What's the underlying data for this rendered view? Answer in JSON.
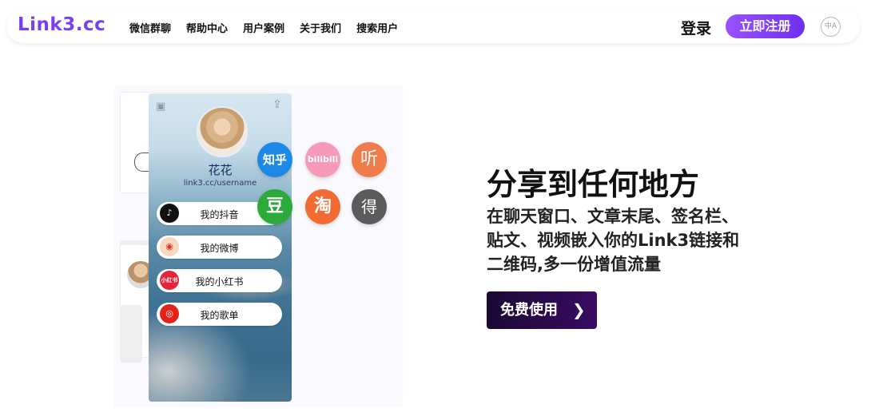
{
  "header": {
    "logo": "Link3.cc",
    "nav_items": [
      "微信群聊",
      "帮助中心",
      "用户案例",
      "关于我们",
      "搜索用户"
    ],
    "login_label": "登录",
    "register_label": "立即注册",
    "lang_icon": "translate-icon"
  },
  "illustration": {
    "profile_name": "花花",
    "profile_url": "link3.cc/username",
    "links": [
      {
        "label": "我的抖音",
        "icon": "douyin-icon",
        "glyph": "♪"
      },
      {
        "label": "我的微博",
        "icon": "weibo-icon",
        "glyph": "◉"
      },
      {
        "label": "我的小红书",
        "icon": "xiaohongshu-icon",
        "glyph": "小红书"
      },
      {
        "label": "我的歌单",
        "icon": "netease-music-icon",
        "glyph": "◎"
      }
    ],
    "bubbles": [
      {
        "text": "知乎",
        "icon": "zhihu-icon"
      },
      {
        "text": "bilibili",
        "icon": "bilibili-icon"
      },
      {
        "text": "听",
        "icon": "ting-icon"
      },
      {
        "text": "豆",
        "icon": "douban-icon"
      },
      {
        "text": "淘",
        "icon": "taobao-icon"
      },
      {
        "text": "得",
        "icon": "dedao-icon"
      }
    ]
  },
  "hero": {
    "headline": "分享到任何地方",
    "description": "在聊天窗口、文章末尾、签名栏、贴文、视频嵌入你的Link3链接和二维码,多一份增值流量",
    "cta_label": "免费使用"
  },
  "colors": {
    "brand": "#7a3ff2",
    "register_gradient_start": "#9a52ff",
    "register_gradient_end": "#6d2ff0",
    "cta_bg": "#2a0a4a"
  }
}
